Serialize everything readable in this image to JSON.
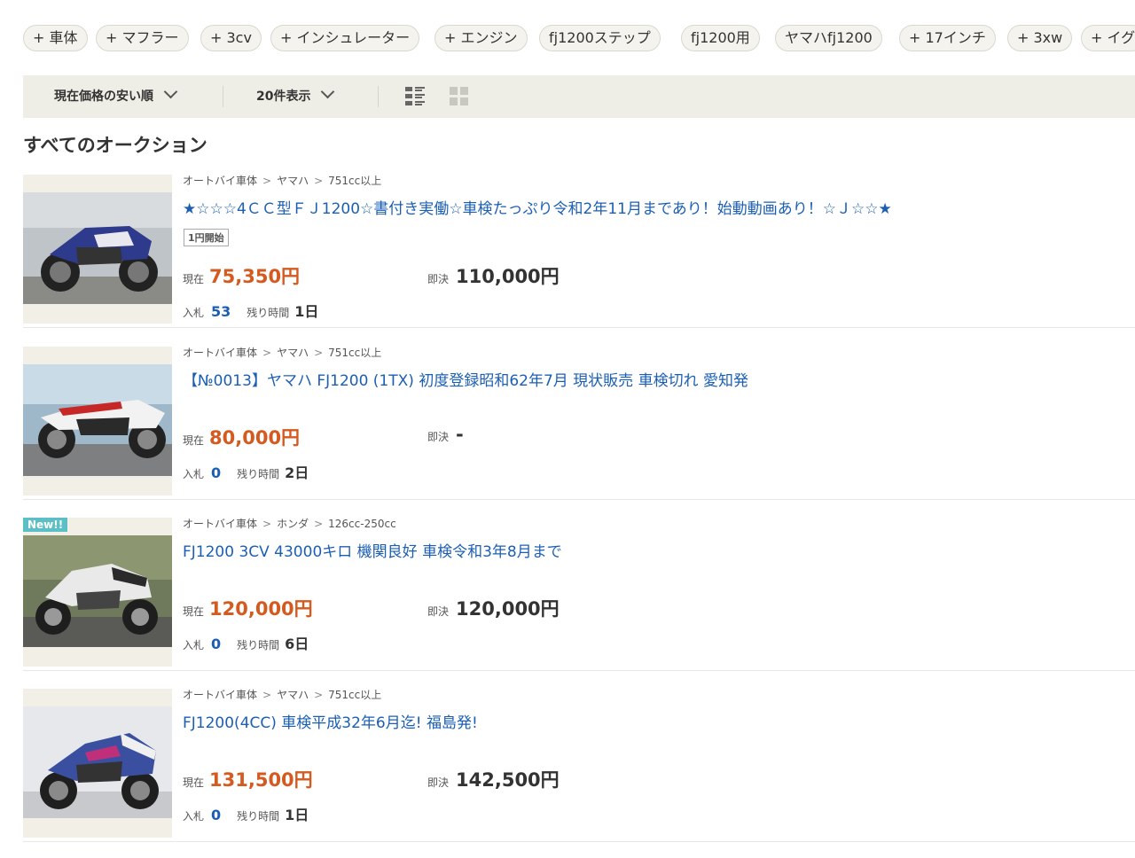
{
  "tags": [
    {
      "label": "+ 車体"
    },
    {
      "label": "+ マフラー"
    },
    {
      "label": "+ 3cv"
    },
    {
      "label": "+ インシュレーター"
    },
    {
      "label": "+ エンジン"
    },
    {
      "label": "fj1200ステップ"
    },
    {
      "label": "fj1200用"
    },
    {
      "label": "ヤマハfj1200"
    },
    {
      "label": "+ 17インチ"
    },
    {
      "label": "+ 3xw"
    },
    {
      "label": "+ イグ"
    }
  ],
  "toolbar": {
    "sort_label": "現在価格の安い順",
    "count_label": "20件表示",
    "list_view_icon": "list-view-icon",
    "grid_view_icon": "grid-view-icon"
  },
  "section_title": "すべてのオークション",
  "labels": {
    "current": "現在",
    "buy_now": "即決",
    "bids": "入札",
    "remaining": "残り時間"
  },
  "items": [
    {
      "categories": [
        "オートバイ車体",
        "ヤマハ",
        "751cc以上"
      ],
      "title": "★☆☆☆4ＣＣ型ＦＪ1200☆書付き実働☆車検たっぷり令和2年11月まであり！始動動画あり！☆Ｊ☆☆★",
      "start_badge": "1円開始",
      "new_badge": "",
      "current_price": "75,350円",
      "buy_now_price": "110,000円",
      "bids": "53",
      "time_left": "1日"
    },
    {
      "categories": [
        "オートバイ車体",
        "ヤマハ",
        "751cc以上"
      ],
      "title": "【№0013】ヤマハ FJ1200 (1TX) 初度登録昭和62年7月 現状販売 車検切れ 愛知発",
      "start_badge": "",
      "new_badge": "",
      "current_price": "80,000円",
      "buy_now_price": "-",
      "bids": "0",
      "time_left": "2日"
    },
    {
      "categories": [
        "オートバイ車体",
        "ホンダ",
        "126cc-250cc"
      ],
      "title": "FJ1200 3CV 43000キロ 機関良好 車検令和3年8月まで",
      "start_badge": "",
      "new_badge": "New!!",
      "current_price": "120,000円",
      "buy_now_price": "120,000円",
      "bids": "0",
      "time_left": "6日"
    },
    {
      "categories": [
        "オートバイ車体",
        "ヤマハ",
        "751cc以上"
      ],
      "title": "FJ1200(4CC) 車検平成32年6月迄! 福島発!",
      "start_badge": "",
      "new_badge": "",
      "current_price": "131,500円",
      "buy_now_price": "142,500円",
      "bids": "0",
      "time_left": "1日"
    }
  ],
  "colors": {
    "link": "#1b5fb4",
    "price": "#d45a1f",
    "toolbar_bg": "#efeee6",
    "new_badge": "#5bbfc5"
  }
}
